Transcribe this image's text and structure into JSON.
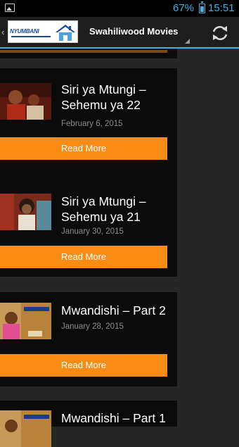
{
  "status_bar": {
    "battery": "67%",
    "time": "15:51",
    "accent_color": "#35b5e5"
  },
  "action_bar": {
    "logo_text": "NYUMBANI",
    "title": "Swahiliwood Movies"
  },
  "posts": [
    {
      "title": "Siri ya Mtungi – Sehemu ya 22",
      "date": "February 6, 2015",
      "read_more": "Read More"
    },
    {
      "title": "Siri ya Mtungi – Sehemu ya 21",
      "date": "January 30, 2015",
      "read_more": "Read More"
    },
    {
      "title": "Mwandishi – Part 2",
      "date": "January 28, 2015",
      "read_more": "Read More"
    },
    {
      "title": "Mwandishi – Part 1",
      "date": "",
      "read_more": ""
    }
  ],
  "colors": {
    "button": "#fa8c16",
    "card": "#0b0b0b",
    "background": "#262626"
  }
}
